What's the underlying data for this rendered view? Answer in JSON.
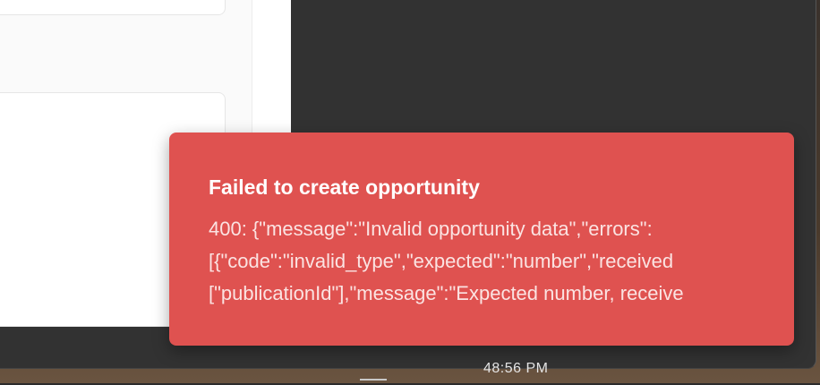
{
  "toast": {
    "title": "Failed to create opportunity",
    "lines": [
      "400: {\"message\":\"Invalid opportunity data\",\"errors\":",
      "[{\"code\":\"invalid_type\",\"expected\":\"number\",\"received",
      "[\"publicationId\"],\"message\":\"Expected number, receive"
    ],
    "color": "#df5250"
  },
  "taskbar": {
    "clock_fragment": "48:56 PM"
  }
}
